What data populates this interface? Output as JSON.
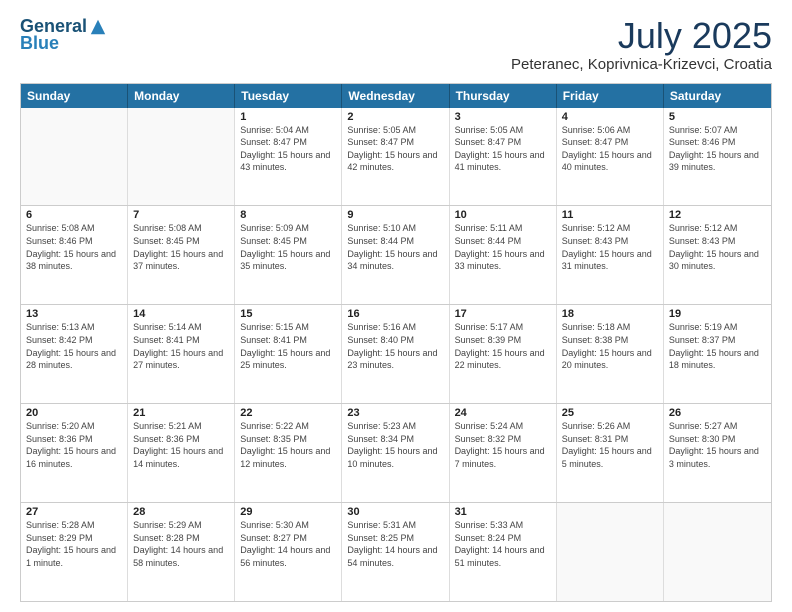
{
  "header": {
    "logo_general": "General",
    "logo_blue": "Blue",
    "title": "July 2025",
    "location": "Peteranec, Koprivnica-Krizevci, Croatia"
  },
  "days_of_week": [
    "Sunday",
    "Monday",
    "Tuesday",
    "Wednesday",
    "Thursday",
    "Friday",
    "Saturday"
  ],
  "weeks": [
    [
      {
        "day": "",
        "empty": true
      },
      {
        "day": "",
        "empty": true
      },
      {
        "day": "1",
        "sunrise": "Sunrise: 5:04 AM",
        "sunset": "Sunset: 8:47 PM",
        "daylight": "Daylight: 15 hours and 43 minutes."
      },
      {
        "day": "2",
        "sunrise": "Sunrise: 5:05 AM",
        "sunset": "Sunset: 8:47 PM",
        "daylight": "Daylight: 15 hours and 42 minutes."
      },
      {
        "day": "3",
        "sunrise": "Sunrise: 5:05 AM",
        "sunset": "Sunset: 8:47 PM",
        "daylight": "Daylight: 15 hours and 41 minutes."
      },
      {
        "day": "4",
        "sunrise": "Sunrise: 5:06 AM",
        "sunset": "Sunset: 8:47 PM",
        "daylight": "Daylight: 15 hours and 40 minutes."
      },
      {
        "day": "5",
        "sunrise": "Sunrise: 5:07 AM",
        "sunset": "Sunset: 8:46 PM",
        "daylight": "Daylight: 15 hours and 39 minutes."
      }
    ],
    [
      {
        "day": "6",
        "sunrise": "Sunrise: 5:08 AM",
        "sunset": "Sunset: 8:46 PM",
        "daylight": "Daylight: 15 hours and 38 minutes."
      },
      {
        "day": "7",
        "sunrise": "Sunrise: 5:08 AM",
        "sunset": "Sunset: 8:45 PM",
        "daylight": "Daylight: 15 hours and 37 minutes."
      },
      {
        "day": "8",
        "sunrise": "Sunrise: 5:09 AM",
        "sunset": "Sunset: 8:45 PM",
        "daylight": "Daylight: 15 hours and 35 minutes."
      },
      {
        "day": "9",
        "sunrise": "Sunrise: 5:10 AM",
        "sunset": "Sunset: 8:44 PM",
        "daylight": "Daylight: 15 hours and 34 minutes."
      },
      {
        "day": "10",
        "sunrise": "Sunrise: 5:11 AM",
        "sunset": "Sunset: 8:44 PM",
        "daylight": "Daylight: 15 hours and 33 minutes."
      },
      {
        "day": "11",
        "sunrise": "Sunrise: 5:12 AM",
        "sunset": "Sunset: 8:43 PM",
        "daylight": "Daylight: 15 hours and 31 minutes."
      },
      {
        "day": "12",
        "sunrise": "Sunrise: 5:12 AM",
        "sunset": "Sunset: 8:43 PM",
        "daylight": "Daylight: 15 hours and 30 minutes."
      }
    ],
    [
      {
        "day": "13",
        "sunrise": "Sunrise: 5:13 AM",
        "sunset": "Sunset: 8:42 PM",
        "daylight": "Daylight: 15 hours and 28 minutes."
      },
      {
        "day": "14",
        "sunrise": "Sunrise: 5:14 AM",
        "sunset": "Sunset: 8:41 PM",
        "daylight": "Daylight: 15 hours and 27 minutes."
      },
      {
        "day": "15",
        "sunrise": "Sunrise: 5:15 AM",
        "sunset": "Sunset: 8:41 PM",
        "daylight": "Daylight: 15 hours and 25 minutes."
      },
      {
        "day": "16",
        "sunrise": "Sunrise: 5:16 AM",
        "sunset": "Sunset: 8:40 PM",
        "daylight": "Daylight: 15 hours and 23 minutes."
      },
      {
        "day": "17",
        "sunrise": "Sunrise: 5:17 AM",
        "sunset": "Sunset: 8:39 PM",
        "daylight": "Daylight: 15 hours and 22 minutes."
      },
      {
        "day": "18",
        "sunrise": "Sunrise: 5:18 AM",
        "sunset": "Sunset: 8:38 PM",
        "daylight": "Daylight: 15 hours and 20 minutes."
      },
      {
        "day": "19",
        "sunrise": "Sunrise: 5:19 AM",
        "sunset": "Sunset: 8:37 PM",
        "daylight": "Daylight: 15 hours and 18 minutes."
      }
    ],
    [
      {
        "day": "20",
        "sunrise": "Sunrise: 5:20 AM",
        "sunset": "Sunset: 8:36 PM",
        "daylight": "Daylight: 15 hours and 16 minutes."
      },
      {
        "day": "21",
        "sunrise": "Sunrise: 5:21 AM",
        "sunset": "Sunset: 8:36 PM",
        "daylight": "Daylight: 15 hours and 14 minutes."
      },
      {
        "day": "22",
        "sunrise": "Sunrise: 5:22 AM",
        "sunset": "Sunset: 8:35 PM",
        "daylight": "Daylight: 15 hours and 12 minutes."
      },
      {
        "day": "23",
        "sunrise": "Sunrise: 5:23 AM",
        "sunset": "Sunset: 8:34 PM",
        "daylight": "Daylight: 15 hours and 10 minutes."
      },
      {
        "day": "24",
        "sunrise": "Sunrise: 5:24 AM",
        "sunset": "Sunset: 8:32 PM",
        "daylight": "Daylight: 15 hours and 7 minutes."
      },
      {
        "day": "25",
        "sunrise": "Sunrise: 5:26 AM",
        "sunset": "Sunset: 8:31 PM",
        "daylight": "Daylight: 15 hours and 5 minutes."
      },
      {
        "day": "26",
        "sunrise": "Sunrise: 5:27 AM",
        "sunset": "Sunset: 8:30 PM",
        "daylight": "Daylight: 15 hours and 3 minutes."
      }
    ],
    [
      {
        "day": "27",
        "sunrise": "Sunrise: 5:28 AM",
        "sunset": "Sunset: 8:29 PM",
        "daylight": "Daylight: 15 hours and 1 minute."
      },
      {
        "day": "28",
        "sunrise": "Sunrise: 5:29 AM",
        "sunset": "Sunset: 8:28 PM",
        "daylight": "Daylight: 14 hours and 58 minutes."
      },
      {
        "day": "29",
        "sunrise": "Sunrise: 5:30 AM",
        "sunset": "Sunset: 8:27 PM",
        "daylight": "Daylight: 14 hours and 56 minutes."
      },
      {
        "day": "30",
        "sunrise": "Sunrise: 5:31 AM",
        "sunset": "Sunset: 8:25 PM",
        "daylight": "Daylight: 14 hours and 54 minutes."
      },
      {
        "day": "31",
        "sunrise": "Sunrise: 5:33 AM",
        "sunset": "Sunset: 8:24 PM",
        "daylight": "Daylight: 14 hours and 51 minutes."
      },
      {
        "day": "",
        "empty": true
      },
      {
        "day": "",
        "empty": true
      }
    ]
  ]
}
